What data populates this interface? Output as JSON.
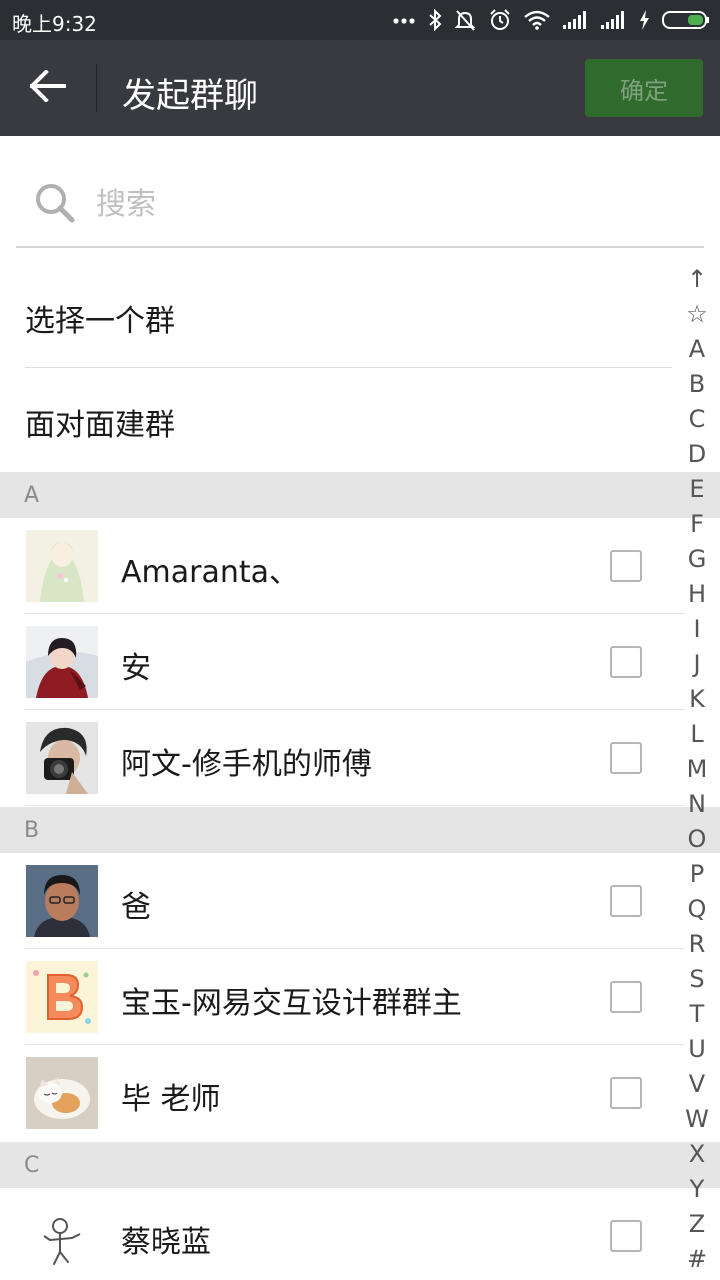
{
  "status_bar": {
    "time": "晚上9:32",
    "icons": [
      "more-dots-icon",
      "bluetooth-icon",
      "mute-icon",
      "alarm-icon",
      "wifi-icon",
      "signal-icon",
      "signal-icon",
      "charging-icon",
      "battery-icon"
    ]
  },
  "app_bar": {
    "title": "发起群聊",
    "confirm_label": "确定",
    "back_icon": "arrow-left-icon",
    "colors": {
      "bar": "#393a3f",
      "confirm_bg": "#2e6b2c",
      "confirm_text": "#7fa07e"
    }
  },
  "search": {
    "placeholder": "搜索",
    "value": "",
    "icon": "search-icon"
  },
  "options": [
    {
      "label": "选择一个群"
    },
    {
      "label": "面对面建群"
    }
  ],
  "sections": [
    {
      "letter": "A",
      "contacts": [
        {
          "name": "Amaranta、",
          "avatar": "avatar-girl-illustration",
          "checked": false
        },
        {
          "name": "安",
          "avatar": "avatar-anime-character",
          "checked": false
        },
        {
          "name": "阿文-修手机的师傅",
          "avatar": "avatar-camera-photographer",
          "checked": false
        }
      ]
    },
    {
      "letter": "B",
      "contacts": [
        {
          "name": "爸",
          "avatar": "avatar-man-photo",
          "checked": false
        },
        {
          "name": "宝玉-网易交互设计群群主",
          "avatar": "avatar-letter-b",
          "checked": false
        },
        {
          "name": "毕 老师",
          "avatar": "avatar-sleeping-cat",
          "checked": false
        }
      ]
    },
    {
      "letter": "C",
      "contacts": [
        {
          "name": "蔡晓蓝",
          "avatar": "avatar-stick-figure",
          "checked": false
        }
      ]
    }
  ],
  "index_bar": [
    "↑",
    "☆",
    "A",
    "B",
    "C",
    "D",
    "E",
    "F",
    "G",
    "H",
    "I",
    "J",
    "K",
    "L",
    "M",
    "N",
    "O",
    "P",
    "Q",
    "R",
    "S",
    "T",
    "U",
    "V",
    "W",
    "X",
    "Y",
    "Z",
    "#"
  ]
}
